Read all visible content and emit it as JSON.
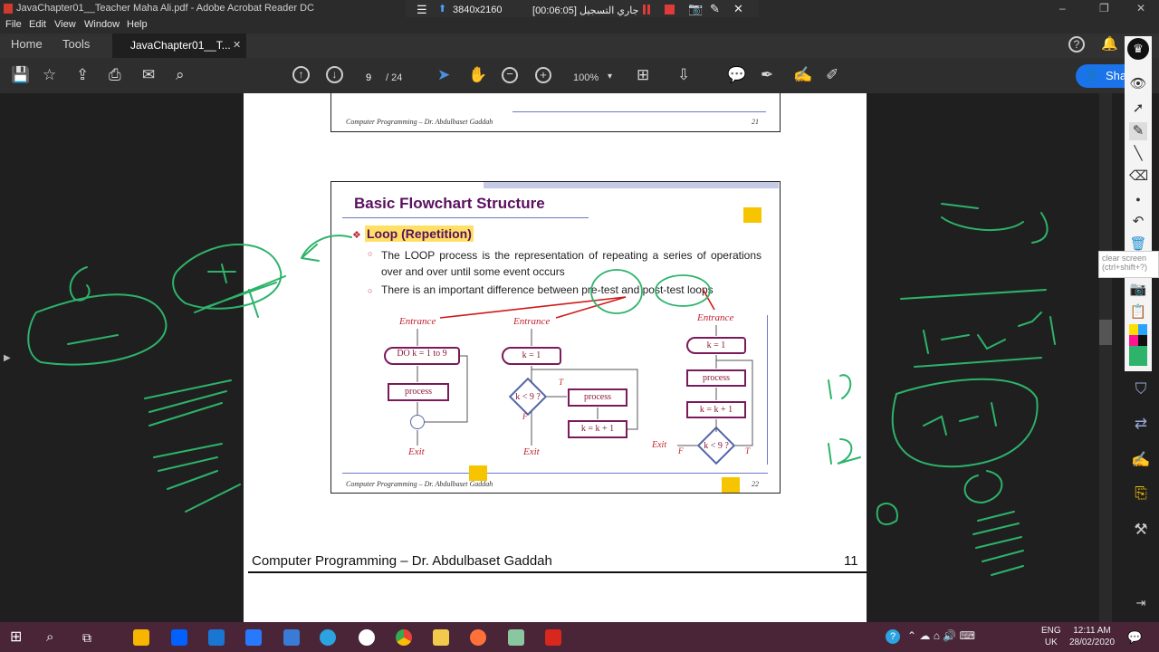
{
  "window": {
    "title": "JavaChapter01__Teacher Maha Ali.pdf - Adobe Acrobat Reader DC",
    "controls": [
      "–",
      "❐",
      "✕"
    ]
  },
  "recorder": {
    "resolution": "3840x2160",
    "status": "جاري التسجيل [00:06:05]"
  },
  "menu": [
    "File",
    "Edit",
    "View",
    "Window",
    "Help"
  ],
  "tabs": {
    "home": "Home",
    "tools": "Tools",
    "document": "JavaChapter01__T...",
    "close": "✕"
  },
  "toolbar": {
    "page_current": "9",
    "page_total": "/ 24",
    "zoom": "100%",
    "share": "Sha"
  },
  "prev_slide": {
    "footer": "Computer Programming – Dr. Abdulbaset  Gaddah",
    "page": "21"
  },
  "slide": {
    "title": "Basic Flowchart Structure",
    "heading": "Loop (Repetition)",
    "bullets": [
      "The LOOP process is the representation of repeating a series of operations over and over until some event occurs",
      "There is an important difference between pre-test and post-test loops"
    ],
    "footer": "Computer Programming – Dr. Abdulbaset  Gaddah",
    "page": "22",
    "flow1": {
      "entrance": "Entrance",
      "do": "DO k = 1 to 9",
      "process": "process",
      "exit": "Exit"
    },
    "flow2": {
      "entrance": "Entrance",
      "init": "k = 1",
      "cond": "k < 9 ?",
      "t": "T",
      "f": "F",
      "process": "process",
      "inc": "k = k + 1",
      "exit": "Exit"
    },
    "flow3": {
      "entrance": "Entrance",
      "init": "k = 1",
      "process": "process",
      "inc": "k = k + 1",
      "cond": "k < 9 ?",
      "exit": "Exit",
      "f": "F",
      "t": "T"
    }
  },
  "page_footer": {
    "text": "Computer Programming – Dr. Abdulbaset Gaddah",
    "page": "11"
  },
  "tooltip": {
    "line1": "clear screen",
    "line2": "(ctrl+shift+?)"
  },
  "taskbar": {
    "lang": "ENG",
    "region": "UK",
    "time": "12:11 AM",
    "date": "28/02/2020"
  },
  "colors": {
    "title_purple": "#5a1060",
    "flow_red": "#c0222e",
    "ink_green": "#2db36a",
    "highlight": "#ffe066",
    "share_blue": "#1a73e8"
  }
}
